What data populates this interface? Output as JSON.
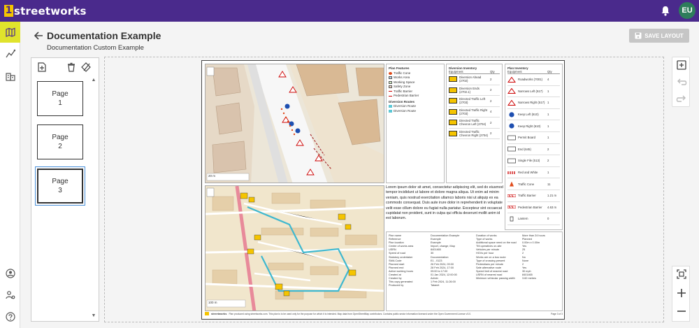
{
  "app": {
    "logo_number": "1",
    "logo_text": "streetworks",
    "user_initials": "EU"
  },
  "header": {
    "title": "Documentation Example",
    "subtitle": "Documentation Custom Example",
    "save_label": "SAVE LAYOUT"
  },
  "pages": [
    {
      "label": "Page",
      "number": "1"
    },
    {
      "label": "Page",
      "number": "2"
    },
    {
      "label": "Page",
      "number": "3"
    }
  ],
  "selected_page": 3,
  "legend": {
    "title": "Plan Features",
    "items": [
      "Traffic Cone",
      "Works Area",
      "Working Space",
      "Safety Zone",
      "Traffic Barrier",
      "Pedestrian Barrier"
    ],
    "routes_title": "Diversion Routes",
    "routes": [
      "Diversion Route",
      "Diversion Route"
    ]
  },
  "diversion_inventory": {
    "title": "Diversion Inventory",
    "col_equipment": "Equipment",
    "col_qty": "Qty",
    "rows": [
      {
        "name": "Diversion Ahead (2702)",
        "qty": "2",
        "color": "#f5c400"
      },
      {
        "name": "Diversion Ends (2702.1)",
        "qty": "2",
        "color": "#f5c400"
      },
      {
        "name": "Directed Traffic Left (2703)",
        "qty": "2",
        "color": "#f5c400"
      },
      {
        "name": "Directed Traffic Right (2703)",
        "qty": "4",
        "color": "#f5c400"
      },
      {
        "name": "Directed Traffic Chevron Left (2704)",
        "qty": "2",
        "color": "#f5c400"
      },
      {
        "name": "Directed Traffic Chevron Right (2704)",
        "qty": "2",
        "color": "#f5c400"
      }
    ]
  },
  "plan_inventory": {
    "title": "Plan Inventory",
    "col_equipment": "Equipment",
    "col_qty": "Qty",
    "rows": [
      {
        "name": "Roadworks (7001)",
        "qty": "4",
        "kind": "triangle"
      },
      {
        "name": "Narrows Left (517)",
        "qty": "1",
        "kind": "triangle"
      },
      {
        "name": "Narrows Right (517)",
        "qty": "1",
        "kind": "triangle"
      },
      {
        "name": "Keep Left (610)",
        "qty": "1",
        "kind": "circle"
      },
      {
        "name": "Keep Right (610)",
        "qty": "1",
        "kind": "circle"
      },
      {
        "name": "Permit Board",
        "qty": "1",
        "kind": "rect"
      },
      {
        "name": "End (645)",
        "qty": "2",
        "kind": "rect"
      },
      {
        "name": "Single File (513)",
        "qty": "2",
        "kind": "rect"
      },
      {
        "name": "Red and White",
        "qty": "1",
        "kind": "stripe"
      },
      {
        "name": "Traffic Cone",
        "qty": "11",
        "kind": "cone"
      },
      {
        "name": "Traffic Barrier",
        "qty": "1.21 m",
        "kind": "barrier"
      },
      {
        "name": "Pedestrian Barrier",
        "qty": "4.63 m",
        "kind": "barrier"
      },
      {
        "name": "Lantern",
        "qty": "0",
        "kind": "lamp"
      }
    ]
  },
  "lorem": "Lorem ipsum dolor sit amet, consectetur adipiscing elit, sed do eiusmod tempor incididunt ut labore et dolore magna aliqua. Ut enim ad minim veniam, quis nostrud exercitation ullamco laboris nisi ut aliquip ex ea commodo consequat. Duis aute irure dolor in reprehenderit in voluptate velit esse cillum dolore eu fugiat nulla pariatur. Excepteur sint occaecat cupidatat non proident, sunt in culpa qui officia deserunt mollit anim id est laborum.",
  "info_left": [
    [
      "Plan name",
      "Documentation Example"
    ],
    [
      "Reference",
      "Example"
    ],
    [
      "Plan location",
      "Example"
    ],
    [
      "Centre of works area",
      "Import, change, Map"
    ],
    [
      "USRN",
      "8401465"
    ],
    [
      "Speed of road",
      "30"
    ],
    [
      "Statutory undertaker",
      "Documentation"
    ],
    [
      "SWA Code",
      "E1 - 0123"
    ],
    [
      "Planned start",
      "26 Feb 2024, 09:00"
    ],
    [
      "Planned end",
      "28 Feb 2024, 17:00"
    ],
    [
      "Active working hours",
      "09:00 to 17:00"
    ],
    [
      "Created at",
      "01 Jan 2024, 12:00:00"
    ],
    [
      "Created by",
      "Admin"
    ],
    [
      "This copy generated",
      "1 Feb 2024, 11:26:00"
    ],
    [
      "Produced by",
      "Tatanet"
    ]
  ],
  "info_right": [
    [
      "Duration of works",
      "More than 24 hours"
    ],
    [
      "Type of works",
      "Planned"
    ],
    [
      "Additional space need on the road",
      "0.00m x 0.00m"
    ],
    [
      "TM operatives on-site",
      "Yes"
    ],
    [
      "Vehicles per minute",
      "25"
    ],
    [
      "HGVs per hour",
      "2"
    ],
    [
      "Works are on a bus route",
      "No"
    ],
    [
      "Type of crossing present",
      "None"
    ],
    [
      "Pedestrians per minute",
      "2"
    ],
    [
      "Safe alternative route",
      "Yes"
    ],
    [
      "Speed limit of nearest road",
      "30 mph"
    ],
    [
      "USRN of nearest road",
      "8401465"
    ],
    [
      "Minimum vehicular passing width",
      "3.60 metres"
    ]
  ],
  "map_scale_1": "20 m",
  "map_scale_2": "100 m",
  "footer_text": "Plan produced using streetworks.com. This plan is to be used only for the purpose for which it is intended. Map data from OpenStreetMap contributors. Contains public sector information licensed under the Open Government Licence v3.0.",
  "footer_page": "Page 3 of 3"
}
